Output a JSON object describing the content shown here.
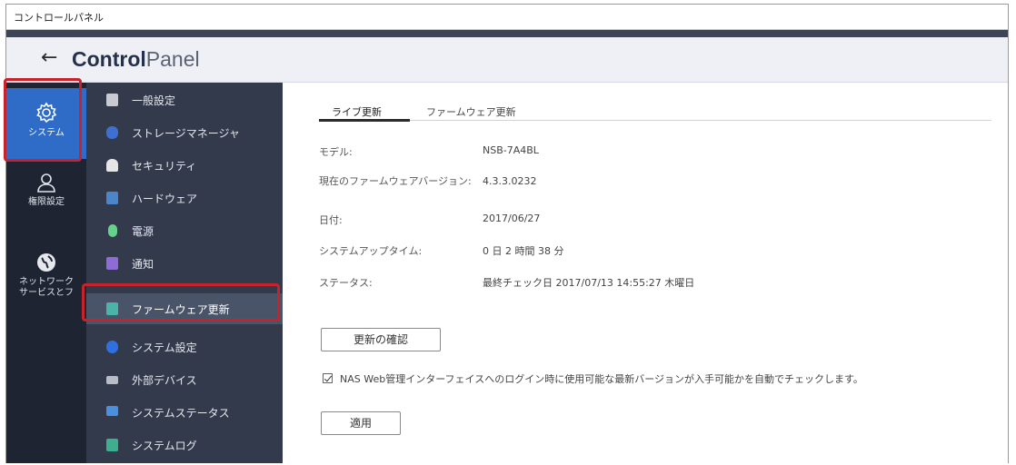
{
  "window": {
    "title": "コントロールパネル"
  },
  "header": {
    "back_glyph": "←",
    "brand_bold": "Control",
    "brand_light": "Panel"
  },
  "rail": {
    "items": [
      {
        "label": "システム",
        "active": true
      },
      {
        "label": "権限設定",
        "active": false
      },
      {
        "label": "ネットワーク\nサービスとフ",
        "active": false
      }
    ]
  },
  "subnav": {
    "items": [
      {
        "label": "一般設定",
        "color": "#c8cbd2"
      },
      {
        "label": "ストレージマネージャ",
        "color": "#3f6fd1"
      },
      {
        "label": "セキュリティ",
        "color": "#e6e6e6"
      },
      {
        "label": "ハードウェア",
        "color": "#4b86c9"
      },
      {
        "label": "電源",
        "color": "#66d18a"
      },
      {
        "label": "通知",
        "color": "#8f6bd6"
      },
      {
        "label": "ファームウェア更新",
        "color": "#4bb3a8",
        "active": true
      },
      {
        "label": "システム設定",
        "color": "#2f6fe0"
      },
      {
        "label": "外部デバイス",
        "color": "#b8bcc6"
      },
      {
        "label": "システムステータス",
        "color": "#4a8fe0"
      },
      {
        "label": "システムログ",
        "color": "#3fae8f"
      }
    ]
  },
  "main": {
    "tabs": [
      {
        "label": "ライブ更新",
        "active": true
      },
      {
        "label": "ファームウェア更新",
        "active": false
      }
    ],
    "info": [
      {
        "label": "モデル:",
        "value": "NSB-7A4BL"
      },
      {
        "label": "現在のファームウェアバージョン:",
        "value": "4.3.3.0232"
      },
      {
        "label": "日付:",
        "value": "2017/06/27"
      },
      {
        "label": "システムアップタイム:",
        "value": "0 日 2 時間 38 分"
      },
      {
        "label": "ステータス:",
        "value": "最終チェック日 2017/07/13 14:55:27 木曜日"
      }
    ],
    "check_button": "更新の確認",
    "auto_check": {
      "checked": true,
      "label": "NAS Web管理インターフェイスへのログイン時に使用可能な最新バージョンが入手可能かを自動でチェックします。"
    },
    "apply_button": "適用"
  }
}
